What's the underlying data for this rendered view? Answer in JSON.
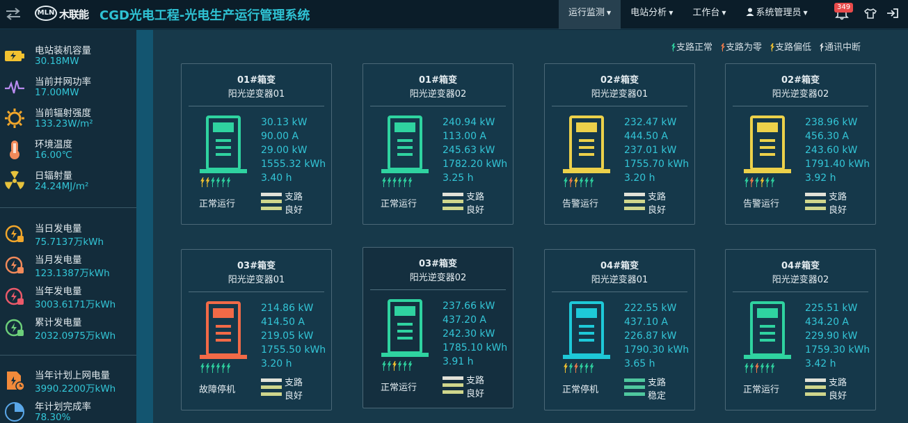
{
  "header": {
    "brand": "木联能",
    "logo_mark": "MLN",
    "title": "CGD光电工程-光电生产运行管理系统",
    "nav": [
      {
        "label": "运行监测",
        "has_caret": true,
        "active": true
      },
      {
        "label": "电站分析",
        "has_caret": true,
        "active": false
      },
      {
        "label": "工作台",
        "has_caret": true,
        "active": false
      },
      {
        "label": "系统管理员",
        "has_caret": true,
        "active": false
      }
    ],
    "notification_count": "349",
    "icons": [
      "swap-icon",
      "user-icon",
      "bell-icon",
      "shirt-icon",
      "logout-icon"
    ]
  },
  "sidebar": {
    "group1": [
      {
        "label": "电站装机容量",
        "value": "30.18MW",
        "icon": "battery-icon"
      },
      {
        "label": "当前并网功率",
        "value": "17.00MW",
        "icon": "pulse-icon"
      },
      {
        "label": "当前辐射强度",
        "value": "133.23W/m²",
        "icon": "sun-icon"
      },
      {
        "label": "环境温度",
        "value": "16.00℃",
        "icon": "thermometer-icon"
      },
      {
        "label": "日辐射量",
        "value": "24.24MJ/m²",
        "icon": "radiation-icon"
      }
    ],
    "group2": [
      {
        "label": "当日发电量",
        "value": "75.7137万kWh",
        "icon": "energy-day-icon"
      },
      {
        "label": "当月发电量",
        "value": "123.1387万kWh",
        "icon": "energy-month-icon"
      },
      {
        "label": "当年发电量",
        "value": "3003.6171万kWh",
        "icon": "energy-year-icon"
      },
      {
        "label": "累计发电量",
        "value": "2032.0975万kWh",
        "icon": "energy-total-icon"
      }
    ],
    "group3": [
      {
        "label": "当年计划上网电量",
        "value": "3990.2200万kWh",
        "icon": "plan-doc-icon"
      },
      {
        "label": "年计划完成率",
        "value": "78.30%",
        "icon": "pie-icon"
      }
    ]
  },
  "legend": [
    {
      "label": "支路正常",
      "color": "#2fd3a0"
    },
    {
      "label": "支路为零",
      "color": "#f07a4a"
    },
    {
      "label": "支路偏低",
      "color": "#f2c230"
    },
    {
      "label": "通讯中断",
      "color": "#e2e6e8"
    }
  ],
  "colors": {
    "normal": "#2fd3a0",
    "warning": "#ecd14a",
    "fault": "#f26a47",
    "stopped": "#1ec9d8",
    "accent": "#33c6d7"
  },
  "cards": [
    {
      "box": "01#箱变",
      "name": "阳光逆变器01",
      "status": "正常运行",
      "color_key": "normal",
      "metrics": [
        "30.13 kW",
        "90.00 A",
        "29.00 kW",
        "1555.32 kWh",
        "3.40 h"
      ],
      "arrows": [
        "#f2c230",
        "#f2c230",
        "#2fd3a0",
        "#2fd3a0",
        "#2fd3a0",
        "#2fd3a0"
      ],
      "branch": [
        "支路",
        "良好"
      ],
      "bar_colors": [
        "#e2e2d8",
        "#cfd68c",
        "#cfd68c"
      ]
    },
    {
      "box": "01#箱变",
      "name": "阳光逆变器02",
      "status": "正常运行",
      "color_key": "normal",
      "metrics": [
        "240.94 kW",
        "113.00 A",
        "245.63 kW",
        "1782.20 kWh",
        "3.25 h"
      ],
      "arrows": [
        "#2fd3a0",
        "#2fd3a0",
        "#2fd3a0",
        "#2fd3a0",
        "#2fd3a0",
        "#2fd3a0"
      ],
      "branch": [
        "支路",
        "良好"
      ],
      "bar_colors": [
        "#e2e2d8",
        "#cfd68c",
        "#cfd68c"
      ]
    },
    {
      "box": "02#箱变",
      "name": "阳光逆变器01",
      "status": "告警运行",
      "color_key": "warning",
      "metrics": [
        "232.47 kW",
        "444.50 A",
        "237.01 kW",
        "1755.70 kWh",
        "3.20 h"
      ],
      "arrows": [
        "#2fd3a0",
        "#f07a4a",
        "#f2c230",
        "#2fd3a0",
        "#2fd3a0",
        "#2fd3a0"
      ],
      "branch": [
        "支路",
        "良好"
      ],
      "bar_colors": [
        "#e2e2d8",
        "#cfd68c",
        "#cfd68c"
      ]
    },
    {
      "box": "02#箱变",
      "name": "阳光逆变器02",
      "status": "告警运行",
      "color_key": "warning",
      "metrics": [
        "238.96 kW",
        "456.30 A",
        "243.60 kW",
        "1791.40 kWh",
        "3.92 h"
      ],
      "arrows": [
        "#2fd3a0",
        "#f07a4a",
        "#2fd3a0",
        "#f2c230",
        "#2fd3a0",
        "#2fd3a0"
      ],
      "branch": [
        "支路",
        "良好"
      ],
      "bar_colors": [
        "#e2e2d8",
        "#cfd68c",
        "#cfd68c"
      ]
    },
    {
      "box": "03#箱变",
      "name": "阳光逆变器01",
      "status": "故障停机",
      "color_key": "fault",
      "metrics": [
        "214.86 kW",
        "414.50 A",
        "219.05 kW",
        "1755.50 kWh",
        "3.20 h"
      ],
      "arrows": [
        "#2fd3a0",
        "#2fd3a0",
        "#2fd3a0",
        "#2fd3a0",
        "#2fd3a0",
        "#2fd3a0"
      ],
      "branch": [
        "支路",
        "良好"
      ],
      "bar_colors": [
        "#e2e2d8",
        "#cfd68c",
        "#cfd68c"
      ]
    },
    {
      "box": "03#箱变",
      "name": "阳光逆变器02",
      "status": "正常运行",
      "color_key": "normal",
      "metrics": [
        "237.66 kW",
        "437.20 A",
        "242.30 kW",
        "1785.10 kWh",
        "3.91 h"
      ],
      "arrows": [
        "#2fd3a0",
        "#2fd3a0",
        "#f2c230",
        "#2fd3a0",
        "#2fd3a0",
        "#2fd3a0"
      ],
      "branch": [
        "支路",
        "良好"
      ],
      "bar_colors": [
        "#e2e2d8",
        "#cfd68c",
        "#cfd68c"
      ]
    },
    {
      "box": "04#箱变",
      "name": "阳光逆变器01",
      "status": "正常停机",
      "color_key": "stopped",
      "metrics": [
        "222.55 kW",
        "437.10 A",
        "226.87 kW",
        "1790.30 kWh",
        "3.65 h"
      ],
      "arrows": [
        "#f2c230",
        "#2fd3a0",
        "#f07a4a",
        "#2fd3a0",
        "#2fd3a0",
        "#2fd3a0"
      ],
      "branch": [
        "支路",
        "稳定"
      ],
      "bar_colors": [
        "#4fc79e",
        "#4fc79e",
        "#4fc79e"
      ]
    },
    {
      "box": "04#箱变",
      "name": "阳光逆变器02",
      "status": "正常运行",
      "color_key": "normal",
      "metrics": [
        "225.51 kW",
        "434.20 A",
        "229.90 kW",
        "1759.30 kWh",
        "3.42 h"
      ],
      "arrows": [
        "#2fd3a0",
        "#2fd3a0",
        "#f07a4a",
        "#2fd3a0",
        "#2fd3a0",
        "#2fd3a0"
      ],
      "branch": [
        "支路",
        "良好"
      ],
      "bar_colors": [
        "#e2e2d8",
        "#cfd68c",
        "#cfd68c"
      ]
    }
  ]
}
